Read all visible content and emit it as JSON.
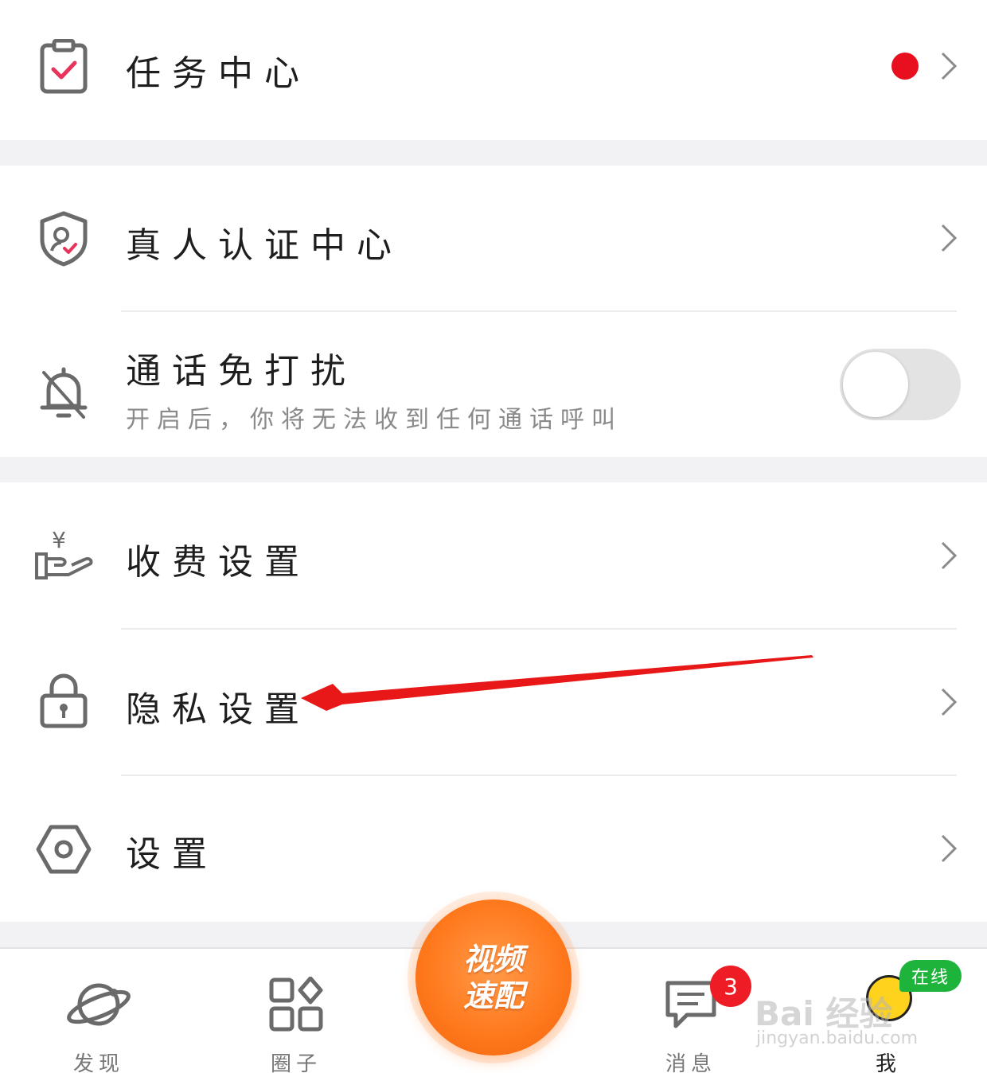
{
  "menu": {
    "task_center": {
      "label": "任务中心",
      "has_dot": true
    },
    "verify_center": {
      "label": "真人认证中心"
    },
    "dnd": {
      "label": "通话免打扰",
      "desc": "开启后，你将无法收到任何通话呼叫",
      "enabled": false
    },
    "charge": {
      "label": "收费设置"
    },
    "privacy": {
      "label": "隐私设置"
    },
    "settings": {
      "label": "设置"
    }
  },
  "tabbar": {
    "discover": "发现",
    "circle": "圈子",
    "center_line1": "视频",
    "center_line2": "速配",
    "messages": "消息",
    "messages_badge": "3",
    "me": "我",
    "online_tag": "在线"
  },
  "watermark": {
    "main": "Bai 经验",
    "sub": "jingyan.baidu.com"
  },
  "colors": {
    "accent_red": "#e8101e",
    "center_orange": "#ff7a1e",
    "online_green": "#1eb43c",
    "arrow_red": "#e81818"
  },
  "icons": [
    "clipboard-check-icon",
    "shield-person-icon",
    "bell-off-icon",
    "yen-hand-icon",
    "lock-icon",
    "hexagon-gear-icon",
    "planet-icon",
    "grid-icon",
    "chat-icon",
    "chevron-right-icon"
  ]
}
